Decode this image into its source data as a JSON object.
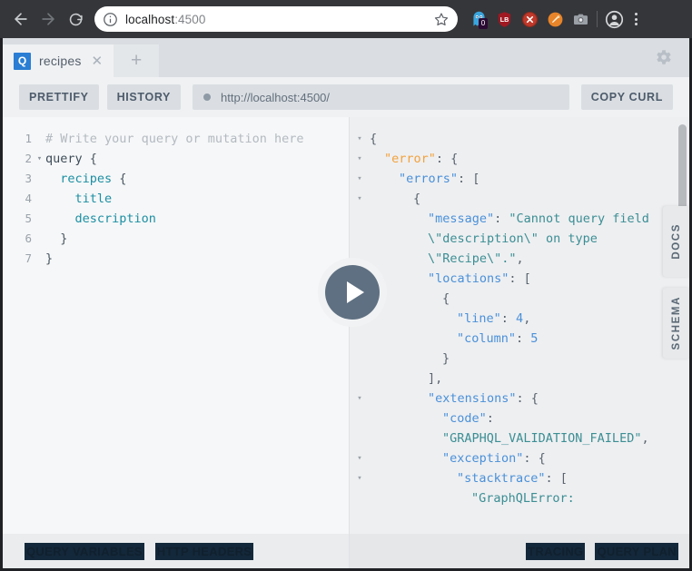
{
  "browser": {
    "back_label": "Back",
    "forward_label": "Forward",
    "reload_label": "Reload",
    "info_icon": "info-circle-icon",
    "url_host": "localhost",
    "url_port": ":4500",
    "bookmark_icon": "star-icon",
    "extensions": [
      {
        "name": "ghostery-extension-icon",
        "badge": "0",
        "color": "#3aa5dd"
      },
      {
        "name": "shield-extension-icon",
        "badge": "",
        "color": "#a01822"
      },
      {
        "name": "blocker-extension-icon",
        "badge": "",
        "color": "#c0392b"
      },
      {
        "name": "orange-extension-icon",
        "badge": "",
        "color": "#e8842a"
      },
      {
        "name": "screenshot-extension-icon",
        "badge": "",
        "color": "#9aa0a6"
      }
    ],
    "profile_icon": "account-avatar-icon",
    "menu_icon": "kebab-menu-icon"
  },
  "playground": {
    "tab": {
      "badge": "Q",
      "title": "recipes",
      "close_icon": "close-icon"
    },
    "new_tab_icon": "plus-icon",
    "settings_icon": "gear-icon",
    "toolbar": {
      "prettify_label": "PRETTIFY",
      "history_label": "HISTORY",
      "endpoint_url": "http://localhost:4500/",
      "copy_curl_label": "COPY CURL"
    },
    "run_button": {
      "name": "play-icon",
      "color": "#5f7082"
    },
    "side_tabs": [
      {
        "label": "DOCS"
      },
      {
        "label": "SCHEMA"
      }
    ],
    "query_editor": {
      "lines": [
        {
          "num": "1",
          "fold": "",
          "segments": [
            {
              "cls": "c-comment",
              "text": "# Write your query or mutation here"
            }
          ]
        },
        {
          "num": "2",
          "fold": "▾",
          "segments": [
            {
              "cls": "c-kw",
              "text": "query"
            },
            {
              "cls": "c-punct",
              "text": " {"
            }
          ]
        },
        {
          "num": "3",
          "fold": "",
          "segments": [
            {
              "cls": "c-field",
              "text": "  recipes"
            },
            {
              "cls": "c-punct",
              "text": " {"
            }
          ]
        },
        {
          "num": "4",
          "fold": "",
          "segments": [
            {
              "cls": "c-field",
              "text": "    title"
            }
          ]
        },
        {
          "num": "5",
          "fold": "",
          "segments": [
            {
              "cls": "c-field",
              "text": "    description"
            }
          ]
        },
        {
          "num": "6",
          "fold": "",
          "segments": [
            {
              "cls": "c-punct",
              "text": "  }"
            }
          ]
        },
        {
          "num": "7",
          "fold": "",
          "segments": [
            {
              "cls": "c-punct",
              "text": "}"
            }
          ]
        }
      ]
    },
    "response_viewer": {
      "lines": [
        {
          "fold": "▾",
          "indent": 0,
          "segments": [
            {
              "cls": "j-punct",
              "text": "{"
            }
          ]
        },
        {
          "fold": "▾",
          "indent": 1,
          "segments": [
            {
              "cls": "j-key-err",
              "text": "\"error\""
            },
            {
              "cls": "j-punct",
              "text": ": {"
            }
          ]
        },
        {
          "fold": "▾",
          "indent": 2,
          "segments": [
            {
              "cls": "j-key",
              "text": "\"errors\""
            },
            {
              "cls": "j-punct",
              "text": ": ["
            }
          ]
        },
        {
          "fold": "▾",
          "indent": 3,
          "segments": [
            {
              "cls": "j-punct",
              "text": "{"
            }
          ]
        },
        {
          "fold": "",
          "indent": 4,
          "segments": [
            {
              "cls": "j-key",
              "text": "\"message\""
            },
            {
              "cls": "j-punct",
              "text": ": "
            },
            {
              "cls": "j-str",
              "text": "\"Cannot query field \\\"description\\\" on type \\\"Recipe\\\".\""
            },
            {
              "cls": "j-punct",
              "text": ","
            }
          ]
        },
        {
          "fold": "▾",
          "indent": 4,
          "segments": [
            {
              "cls": "j-key",
              "text": "\"locations\""
            },
            {
              "cls": "j-punct",
              "text": ": ["
            }
          ]
        },
        {
          "fold": "",
          "indent": 5,
          "segments": [
            {
              "cls": "j-punct",
              "text": "{"
            }
          ]
        },
        {
          "fold": "",
          "indent": 6,
          "segments": [
            {
              "cls": "j-key",
              "text": "\"line\""
            },
            {
              "cls": "j-punct",
              "text": ": "
            },
            {
              "cls": "j-num",
              "text": "4"
            },
            {
              "cls": "j-punct",
              "text": ","
            }
          ]
        },
        {
          "fold": "",
          "indent": 6,
          "segments": [
            {
              "cls": "j-key",
              "text": "\"column\""
            },
            {
              "cls": "j-punct",
              "text": ": "
            },
            {
              "cls": "j-num",
              "text": "5"
            }
          ]
        },
        {
          "fold": "",
          "indent": 5,
          "segments": [
            {
              "cls": "j-punct",
              "text": "}"
            }
          ]
        },
        {
          "fold": "",
          "indent": 4,
          "segments": [
            {
              "cls": "j-punct",
              "text": "],"
            }
          ]
        },
        {
          "fold": "▾",
          "indent": 4,
          "segments": [
            {
              "cls": "j-key",
              "text": "\"extensions\""
            },
            {
              "cls": "j-punct",
              "text": ": {"
            }
          ]
        },
        {
          "fold": "",
          "indent": 5,
          "segments": [
            {
              "cls": "j-key",
              "text": "\"code\""
            },
            {
              "cls": "j-punct",
              "text": ": "
            },
            {
              "cls": "j-str",
              "text": "\"GRAPHQL_VALIDATION_FAILED\""
            },
            {
              "cls": "j-punct",
              "text": ","
            }
          ]
        },
        {
          "fold": "▾",
          "indent": 5,
          "segments": [
            {
              "cls": "j-key",
              "text": "\"exception\""
            },
            {
              "cls": "j-punct",
              "text": ": {"
            }
          ]
        },
        {
          "fold": "▾",
          "indent": 6,
          "segments": [
            {
              "cls": "j-key",
              "text": "\"stacktrace\""
            },
            {
              "cls": "j-punct",
              "text": ": ["
            }
          ]
        },
        {
          "fold": "",
          "indent": 7,
          "segments": [
            {
              "cls": "j-str",
              "text": "\"GraphQLError: "
            }
          ]
        }
      ]
    },
    "bottom_bar": {
      "left": [
        {
          "label": "QUERY VARIABLES"
        },
        {
          "label": "HTTP HEADERS"
        }
      ],
      "right": [
        {
          "label": "TRACING"
        },
        {
          "label": "QUERY PLAN"
        }
      ]
    }
  }
}
